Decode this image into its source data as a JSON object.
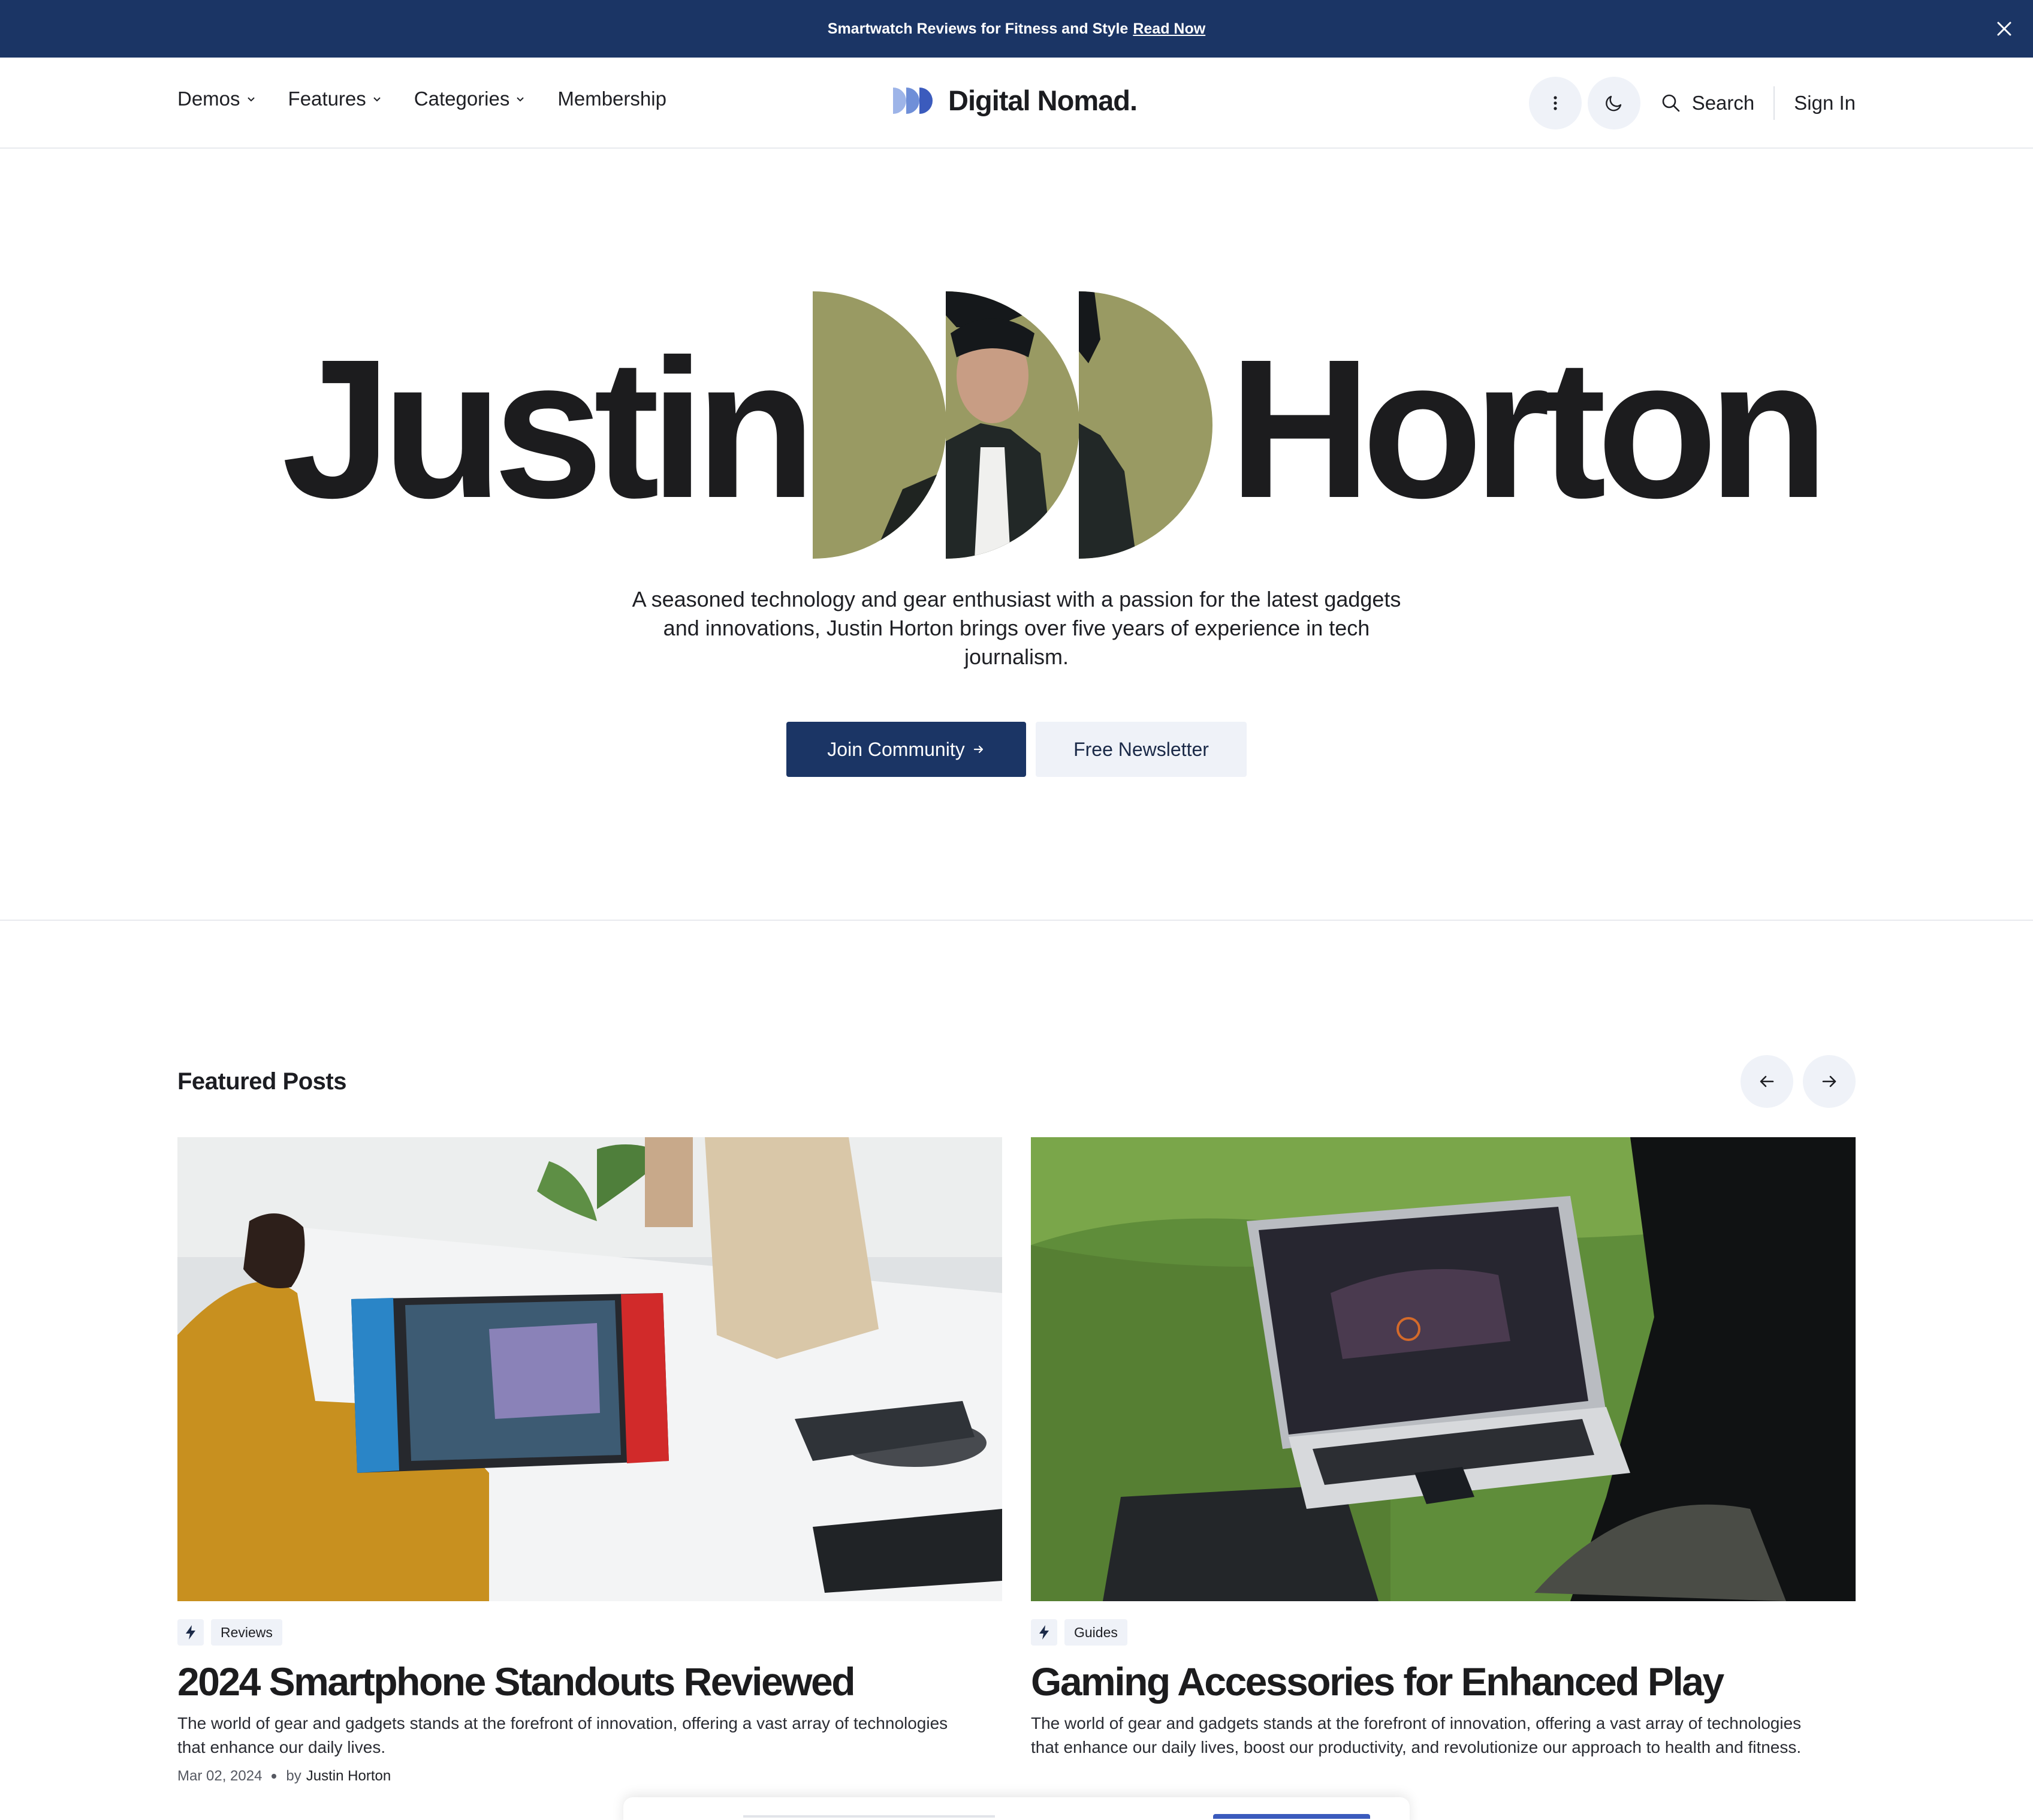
{
  "announcement": {
    "text": "Smartwatch Reviews for Fitness and Style",
    "link": "Read Now"
  },
  "header": {
    "nav": [
      {
        "label": "Demos",
        "has_dropdown": true
      },
      {
        "label": "Features",
        "has_dropdown": true
      },
      {
        "label": "Categories",
        "has_dropdown": true
      },
      {
        "label": "Membership",
        "has_dropdown": false
      }
    ],
    "logo_text": "Digital Nomad.",
    "search_label": "Search",
    "signin_label": "Sign In"
  },
  "hero": {
    "first_name": "Justin",
    "last_name": "Horton",
    "bio": "A seasoned technology and gear enthusiast with a passion for the latest gadgets and innovations, Justin Horton brings over five years of experience in tech journalism.",
    "primary_button": "Join Community",
    "secondary_button": "Free Newsletter"
  },
  "featured": {
    "title": "Featured Posts",
    "posts": [
      {
        "category": "Reviews",
        "title": "2024 Smartphone Standouts Reviewed",
        "excerpt": "The world of gear and gadgets stands at the forefront of innovation, offering a vast array of technologies that enhance our daily lives.",
        "date": "Mar 02, 2024",
        "by": "by",
        "author": "Justin Horton"
      },
      {
        "category": "Guides",
        "title": "Gaming Accessories for Enhanced Play",
        "excerpt": "The world of gear and gadgets stands at the forefront of innovation, offering a vast array of technologies that enhance our daily lives, boost our productivity, and revolutionize our approach to health and fitness."
      }
    ]
  },
  "colors": {
    "brand_navy": "#1b3565",
    "surface_tint": "#eff2f8",
    "hero_olive": "#999a63",
    "text_dark": "#1c1c1e"
  }
}
